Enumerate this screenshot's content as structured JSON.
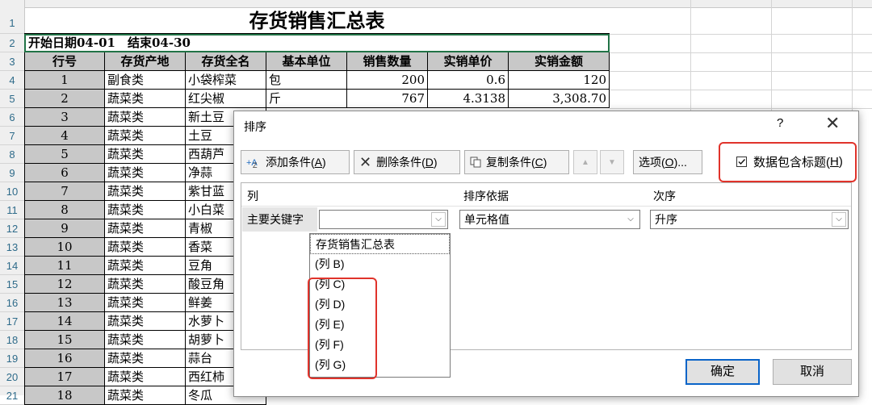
{
  "sheet": {
    "title": "存货销售汇总表",
    "period": "开始日期04-01　结束04-30",
    "row_numbers": [
      "1",
      "2",
      "3",
      "4",
      "5",
      "6",
      "7",
      "8",
      "9",
      "10",
      "11",
      "12",
      "13",
      "14",
      "15",
      "16",
      "17",
      "18",
      "19",
      "20",
      "21"
    ],
    "headers": [
      "行号",
      "存货产地",
      "存货全名",
      "基本单位",
      "销售数量",
      "实销单价",
      "实销金额"
    ],
    "rows": [
      {
        "no": "1",
        "origin": "副食类",
        "name": "小袋榨菜",
        "unit": "包",
        "qty": "200",
        "price": "0.6",
        "amount": "120"
      },
      {
        "no": "2",
        "origin": "蔬菜类",
        "name": "红尖椒",
        "unit": "斤",
        "qty": "767",
        "price": "4.3138",
        "amount": "3,308.70"
      },
      {
        "no": "3",
        "origin": "蔬菜类",
        "name": "新土豆"
      },
      {
        "no": "4",
        "origin": "蔬菜类",
        "name": "土豆"
      },
      {
        "no": "5",
        "origin": "蔬菜类",
        "name": "西葫芦"
      },
      {
        "no": "6",
        "origin": "蔬菜类",
        "name": "净蒜"
      },
      {
        "no": "7",
        "origin": "蔬菜类",
        "name": "紫甘蓝"
      },
      {
        "no": "8",
        "origin": "蔬菜类",
        "name": "小白菜"
      },
      {
        "no": "9",
        "origin": "蔬菜类",
        "name": "青椒"
      },
      {
        "no": "10",
        "origin": "蔬菜类",
        "name": "香菜"
      },
      {
        "no": "11",
        "origin": "蔬菜类",
        "name": "豆角"
      },
      {
        "no": "12",
        "origin": "蔬菜类",
        "name": "酸豆角"
      },
      {
        "no": "13",
        "origin": "蔬菜类",
        "name": "鲜姜"
      },
      {
        "no": "14",
        "origin": "蔬菜类",
        "name": "水萝卜"
      },
      {
        "no": "15",
        "origin": "蔬菜类",
        "name": "胡萝卜"
      },
      {
        "no": "16",
        "origin": "蔬菜类",
        "name": "蒜台"
      },
      {
        "no": "17",
        "origin": "蔬菜类",
        "name": "西红柿"
      },
      {
        "no": "18",
        "origin": "蔬菜类",
        "name": "冬瓜"
      }
    ]
  },
  "dialog": {
    "title": "排序",
    "help": "?",
    "close": "✕",
    "add_condition": "添加条件(",
    "add_key": "A",
    "delete_condition": "删除条件(",
    "delete_key": "D",
    "copy_condition": "复制条件(",
    "copy_key": "C",
    "options": "选项(",
    "options_key": "O",
    "options_suffix": ")...",
    "has_headers": "数据包含标题(",
    "has_headers_key": "H",
    "has_headers_checked": true,
    "col_header": "列",
    "sortby_header": "排序依据",
    "order_header": "次序",
    "primary_key_label": "主要关键字",
    "column_value": "",
    "sortby_value": "单元格值",
    "order_value": "升序",
    "dropdown_options": [
      "存货销售汇总表",
      "(列 B)",
      "(列 C)",
      "(列 D)",
      "(列 E)",
      "(列 F)",
      "(列 G)"
    ],
    "ok": "确定",
    "cancel": "取消"
  },
  "colors": {
    "highlight_red": "#e0332b",
    "selection_green": "#217346",
    "gray_fill": "#c8c8c8",
    "ok_border": "#0a64c8"
  }
}
